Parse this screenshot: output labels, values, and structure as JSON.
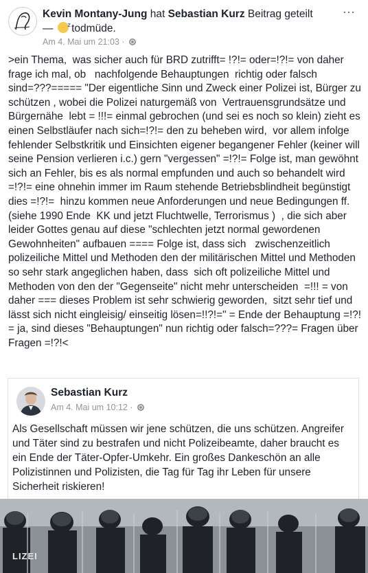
{
  "post": {
    "author": "Kevin Montany-Jung",
    "action": " hat ",
    "shared_author": "Sebastian Kurz",
    "action_rest": " Beitrag geteilt — ",
    "feeling": " todmüde.",
    "timestamp": "Am 4. Mai um 21:03",
    "body": ">ein Thema,  was sicher auch für BRD zutrifft= !?!= oder=!?!= von daher frage ich mal, ob   nachfolgende Behauptungen  richtig oder falsch sind=???===== \"Der eigentliche Sinn und Zweck einer Polizei ist, Bürger zu schützen , wobei die Polizei naturgemäß von  Vertrauensgrundsätze und Bürgernähe  lebt = !!!= einmal gebrochen (und sei es noch so klein) zieht es einen Selbstläufer nach sich=!?!= den zu beheben wird,  vor allem infolge fehlender Selbstkritik und Einsichten eigener begangener Fehler (keiner will seine Pension verlieren i.c.) gern \"vergessen\" =!?!= Folge ist, man gewöhnt sich an Fehler, bis es als normal empfunden und auch so behandelt wird =!?!= eine ohnehin immer im Raum stehende Betriebsblindheit begünstigt dies =!?!=  hinzu kommen neue Anforderungen und neue Bedingungen ff. (siehe 1990 Ende  KK und jetzt Fluchtwelle, Terrorismus )  , die sich aber leider Gottes genau auf diese \"schlechten jetzt normal gewordenen Gewohnheiten\" aufbauen ==== Folge ist, dass sich   zwischenzeitlich polizeiliche Mittel und Methoden den der militärischen Mittel und Methoden so sehr stark angeglichen haben, dass  sich oft polizeiliche Mittel und Methoden von den der \"Gegenseite\" nicht mehr unterscheiden  =!!! = von daher === dieses Problem ist sehr schwierig geworden,  sitzt sehr tief und lässt sich nicht eingleisig/ einseitig lösen=!!?!=\" = Ende der Behauptung =!?! = ja, sind dieses \"Behauptungen\" nun richtig oder falsch=???= Fragen über Fragen =!?!<"
  },
  "shared_post": {
    "author": "Sebastian Kurz",
    "timestamp": "Am 4. Mai um 10:12",
    "body": "Als Gesellschaft müssen wir jene schützen, die uns schützen. Angreifer und Täter sind zu bestrafen und nicht Polizeibeamte, daher braucht es ein Ende der Täter-Opfer-Umkehr. Ein großes Dankeschön an alle Polizistinnen und Polizisten, die Tag für Tag ihr Leben für unsere Sicherheit riskieren!"
  },
  "photo": {
    "shield_text": "LIZEI"
  },
  "icons": {
    "more": "more-options-icon",
    "audience": "globe-icon",
    "feeling": "sleepy-face-icon"
  },
  "colors": {
    "text": "#1d2129",
    "meta": "#90949c",
    "border": "#dddfe2"
  }
}
